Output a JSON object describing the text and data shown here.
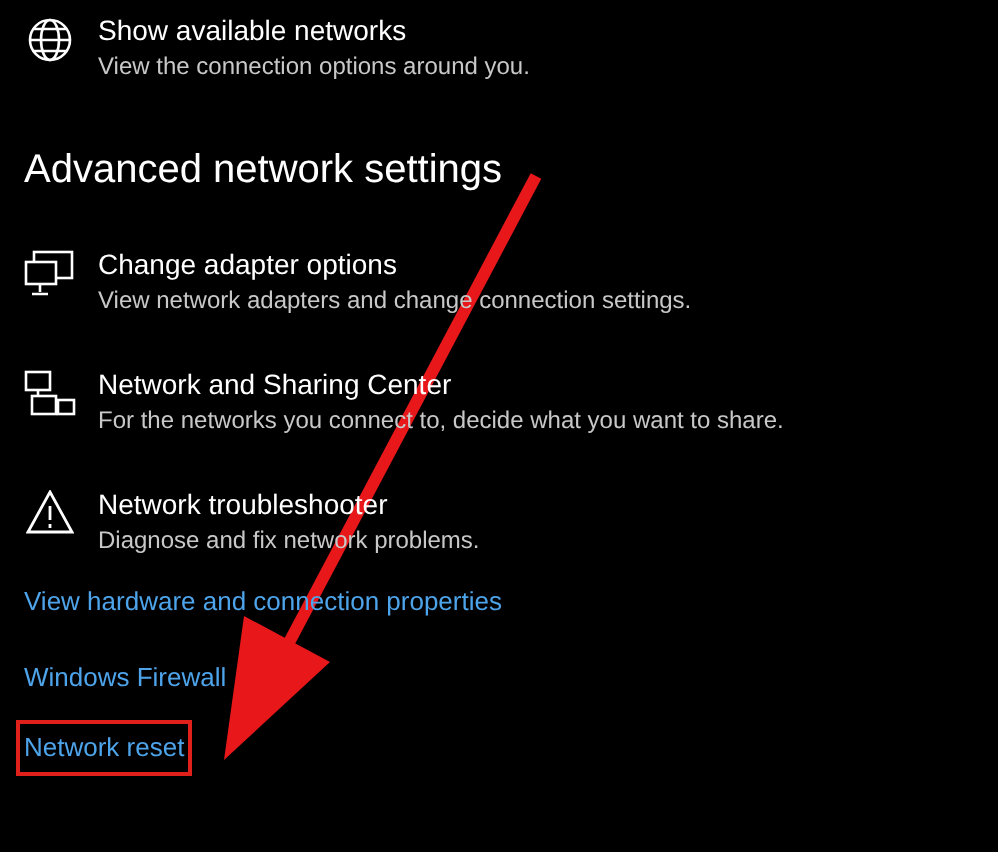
{
  "top_item": {
    "kind": "globe",
    "title": "Show available networks",
    "description": "View the connection options around you."
  },
  "section": {
    "title": "Advanced network settings"
  },
  "items": [
    {
      "kind": "adapter",
      "title": "Change adapter options",
      "description": "View network adapters and change connection settings."
    },
    {
      "kind": "sharing",
      "title": "Network and Sharing Center",
      "description": "For the networks you connect to, decide what you want to share."
    },
    {
      "kind": "warning",
      "title": "Network troubleshooter",
      "description": "Diagnose and fix network problems."
    }
  ],
  "links": [
    {
      "label": "View hardware and connection properties",
      "highlighted": false
    },
    {
      "label": "Windows Firewall",
      "highlighted": false
    },
    {
      "label": "Network reset",
      "highlighted": true
    }
  ],
  "annotation": {
    "kind": "arrow"
  }
}
